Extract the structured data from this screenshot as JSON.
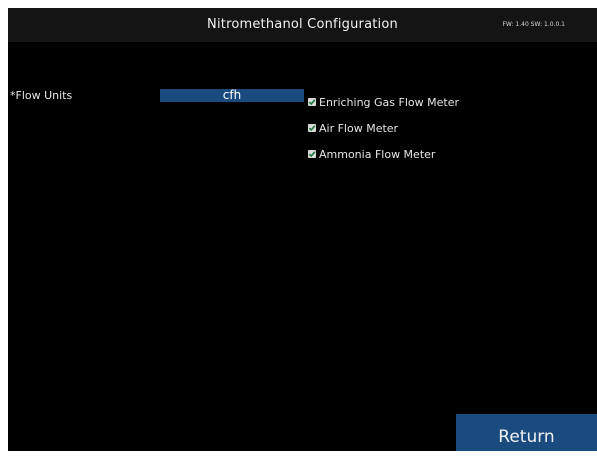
{
  "header": {
    "title": "Nitromethanol Configuration",
    "version": "FW: 1.40 SW: 1.0.0.1"
  },
  "flow_units": {
    "label": "*Flow Units",
    "selected": "cfh"
  },
  "meters": [
    {
      "label": "Enriching Gas Flow Meter",
      "checked": true
    },
    {
      "label": "Air Flow Meter",
      "checked": true
    },
    {
      "label": "Ammonia Flow Meter",
      "checked": true
    }
  ],
  "footer": {
    "return_label": "Return"
  },
  "colors": {
    "accent": "#1a4b7e",
    "background": "#000000",
    "checkbox": "#d9d9d9",
    "checkmark": "#1a7a3a"
  }
}
